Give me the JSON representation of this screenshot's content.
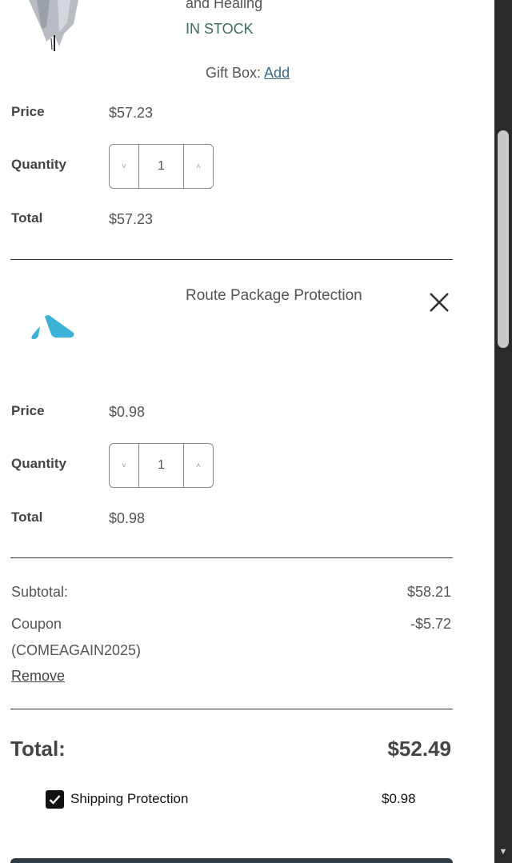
{
  "product": {
    "title_fragment": "and Healing",
    "stock": "IN STOCK",
    "gift_box_label": "Gift Box:",
    "gift_box_link": "Add",
    "price_label": "Price",
    "price": "$57.23",
    "quantity_label": "Quantity",
    "quantity": "1",
    "total_label": "Total",
    "total": "$57.23"
  },
  "route": {
    "title": "Route Package Protection",
    "logo_icon": "route-logo-icon",
    "brand_color": "#3bb3d6",
    "price_label": "Price",
    "price": "$0.98",
    "quantity_label": "Quantity",
    "quantity": "1",
    "total_label": "Total",
    "total": "$0.98"
  },
  "summary": {
    "subtotal_label": "Subtotal:",
    "subtotal": "$58.21",
    "coupon_label": "Coupon",
    "coupon_code": "(COMEAGAIN2025)",
    "coupon_value": "-$5.72",
    "remove_label": "Remove",
    "total_label": "Total:",
    "total": "$52.49"
  },
  "shipping_protection": {
    "label": "Shipping Protection",
    "value": "$0.98",
    "checked": true
  },
  "steppers": {
    "decrement": "˅",
    "increment": "˄"
  }
}
